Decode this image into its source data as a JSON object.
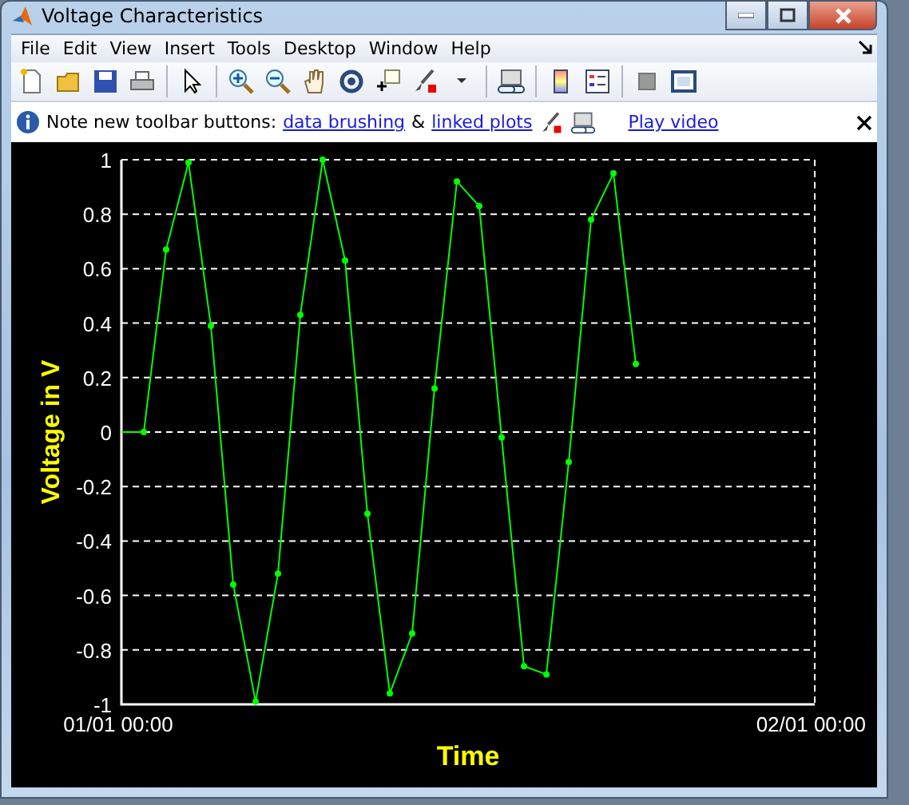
{
  "window": {
    "title": "Voltage Characteristics"
  },
  "menu": [
    "File",
    "Edit",
    "View",
    "Insert",
    "Tools",
    "Desktop",
    "Window",
    "Help"
  ],
  "info_bar": {
    "note": "Note new toolbar buttons:",
    "link_1": "data brushing",
    "joiner": "&",
    "link_2": "linked plots",
    "video_link": "Play video"
  },
  "chart_data": {
    "type": "line",
    "grid": true,
    "xlabel": "Time",
    "ylabel": "Voltage in V",
    "ylim": [
      -1,
      1
    ],
    "yticks": [
      -1,
      -0.8,
      -0.6,
      -0.4,
      -0.2,
      0,
      0.2,
      0.4,
      0.6,
      0.8,
      1
    ],
    "categories": [
      "01/01 00:00",
      null,
      null,
      null,
      null,
      null,
      null,
      null,
      null,
      null,
      null,
      null,
      null,
      null,
      null,
      null,
      null,
      null,
      null,
      null,
      null,
      null,
      null,
      null,
      null,
      null,
      null,
      null,
      null,
      null,
      null,
      "02/01 00:00"
    ],
    "series": [
      {
        "color": "#00ff00",
        "marker": true,
        "values": [
          0,
          0,
          0.67,
          0.99,
          0.39,
          -0.56,
          -0.99,
          -0.52,
          0.43,
          1.0,
          0.63,
          -0.3,
          -0.96,
          -0.74,
          0.16,
          0.92,
          0.83,
          -0.02,
          -0.86,
          -0.89,
          -0.11,
          0.78,
          0.95,
          0.25,
          null,
          null,
          null,
          null,
          null,
          null,
          null,
          null
        ]
      }
    ]
  }
}
